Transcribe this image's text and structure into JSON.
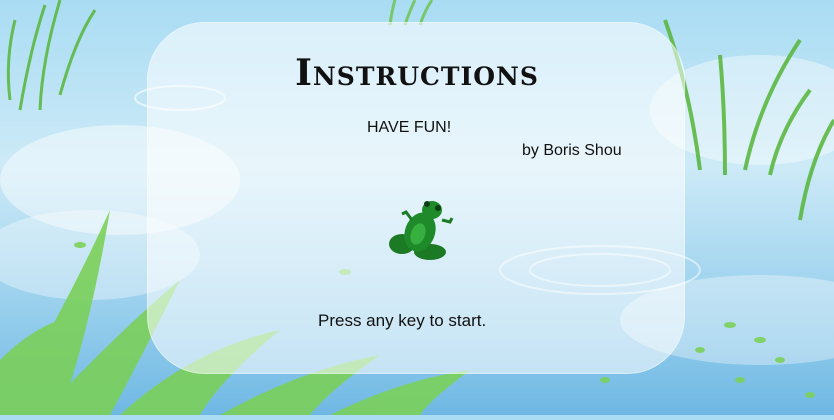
{
  "screen": {
    "title": "Instructions",
    "subtitle": "HAVE FUN!",
    "author": "by Boris Shou",
    "prompt": "Press any key to start."
  },
  "colors": {
    "panel": "#ffffff",
    "water_top": "#a9dcf3",
    "water_bottom": "#6fb8e4",
    "grass": "#6cc24a",
    "frog": "#1f8a2a"
  },
  "icons": {
    "frog": "frog-icon"
  }
}
